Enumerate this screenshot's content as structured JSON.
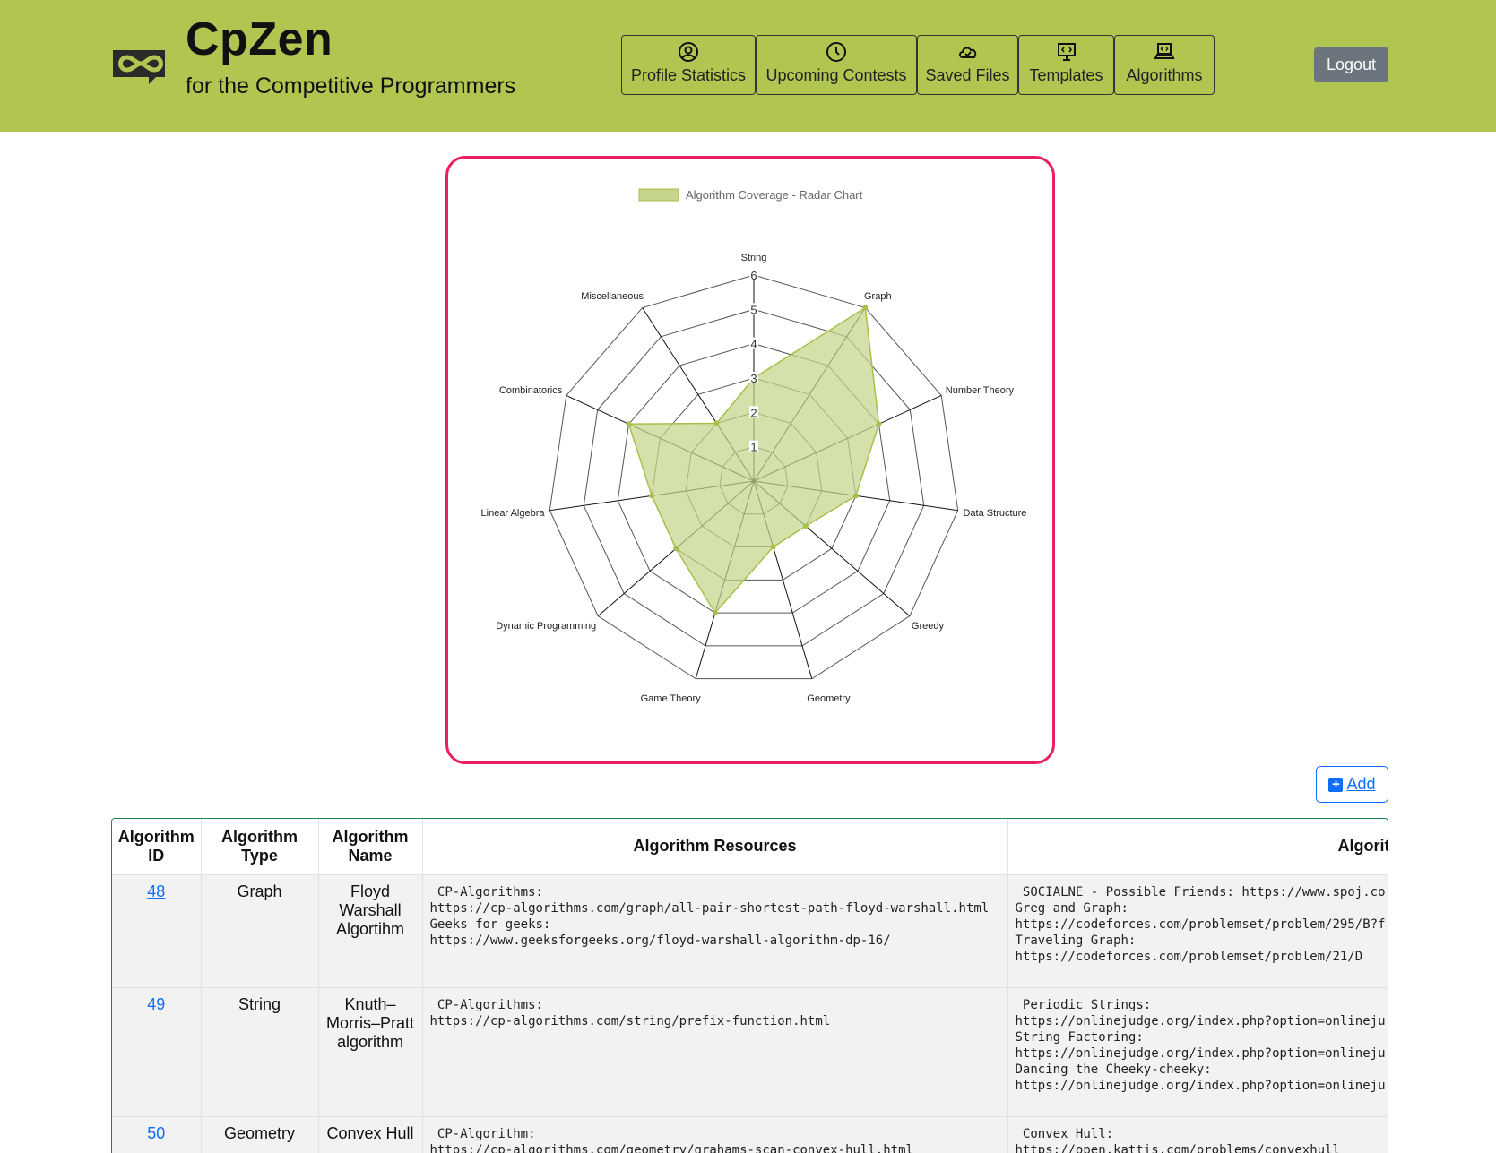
{
  "brand": {
    "title": "CpZen",
    "subtitle": "for the Competitive Programmers"
  },
  "nav": [
    {
      "label": "Profile Statistics",
      "icon": "user-circle-icon"
    },
    {
      "label": "Upcoming Contests",
      "icon": "clock-icon"
    },
    {
      "label": "Saved Files",
      "icon": "cloud-check-icon"
    },
    {
      "label": "Templates",
      "icon": "monitor-code-icon"
    },
    {
      "label": "Algorithms",
      "icon": "laptop-code-icon"
    }
  ],
  "logout_label": "Logout",
  "add_label": "Add",
  "colors": {
    "header": "#b1c551",
    "card_border": "#e91e63",
    "radar_fill": "#c5d58a",
    "radar_stroke": "#a7c04a"
  },
  "chart_data": {
    "type": "radar",
    "legend": "Algorithm Coverage - Radar Chart",
    "categories": [
      "String",
      "Graph",
      "Number Theory",
      "Data Structure",
      "Greedy",
      "Geometry",
      "Game Theory",
      "Dynamic Programming",
      "Linear Algebra",
      "Combinatorics",
      "Miscellaneous"
    ],
    "values": [
      3,
      6,
      4,
      3,
      2,
      2,
      4,
      3,
      3,
      4,
      2
    ],
    "r_ticks": [
      "1",
      "2",
      "3",
      "4",
      "5",
      "6"
    ],
    "r_range": [
      0,
      6
    ],
    "grid": true
  },
  "table": {
    "headers": [
      "Algorithm ID",
      "Algorithm Type",
      "Algorithm Name",
      "Algorithm Resources",
      "Algorithm Problems"
    ],
    "rows": [
      {
        "id": "48",
        "type": "Graph",
        "name": "Floyd Warshall Algortihm",
        "resources": " CP-Algorithms:\nhttps://cp-algorithms.com/graph/all-pair-shortest-path-floyd-warshall.html\nGeeks for geeks:\nhttps://www.geeksforgeeks.org/floyd-warshall-algorithm-dp-16/",
        "problems": " SOCIALNE - Possible Friends: https://www.spoj.co\nGreg and Graph:\nhttps://codeforces.com/problemset/problem/295/B?f\nTraveling Graph:\nhttps://codeforces.com/problemset/problem/21/D"
      },
      {
        "id": "49",
        "type": "String",
        "name": "Knuth–Morris–Pratt algorithm",
        "resources": " CP-Algorithms:\nhttps://cp-algorithms.com/string/prefix-function.html",
        "problems": " Periodic Strings:\nhttps://onlinejudge.org/index.php?option=onlineju\nString Factoring:\nhttps://onlinejudge.org/index.php?option=onlineju\nDancing the Cheeky-cheeky:\nhttps://onlinejudge.org/index.php?option=onlineju"
      },
      {
        "id": "50",
        "type": "Geometry",
        "name": "Convex Hull",
        "resources": " CP-Algorithm:\nhttps://cp-algorithms.com/geometry/grahams-scan-convex-hull.html",
        "problems": " Convex Hull:\nhttps://open.kattis.com/problems/convexhull"
      }
    ]
  }
}
